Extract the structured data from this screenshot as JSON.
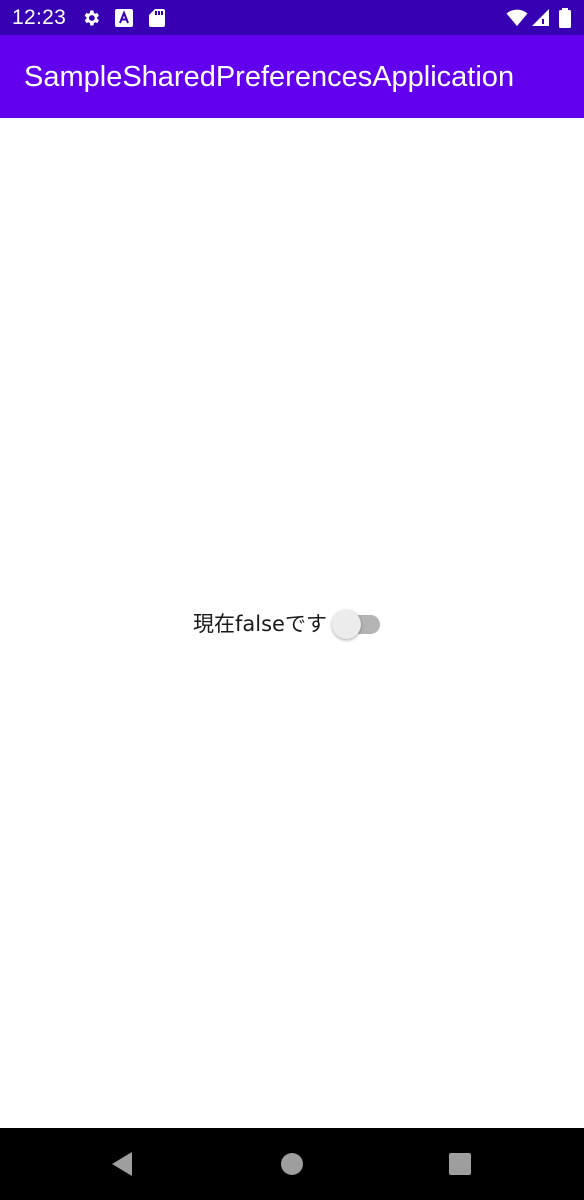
{
  "status_bar": {
    "time": "12:23",
    "icons": [
      "gear-icon",
      "a-square-icon",
      "sd-card-icon",
      "wifi-icon",
      "signal-icon",
      "battery-icon"
    ]
  },
  "app_bar": {
    "title": "SampleSharedPreferencesApplication",
    "color": "#6200ee"
  },
  "main": {
    "switch_label": "現在falseです",
    "switch_checked": false
  },
  "nav_bar": {
    "icons": [
      "back-icon",
      "home-icon",
      "recents-icon"
    ]
  },
  "colors": {
    "status_bar": "#3700b3",
    "app_bar": "#6200ee",
    "switch_track_off": "#b4b4b4",
    "switch_thumb_off": "#ececec"
  }
}
